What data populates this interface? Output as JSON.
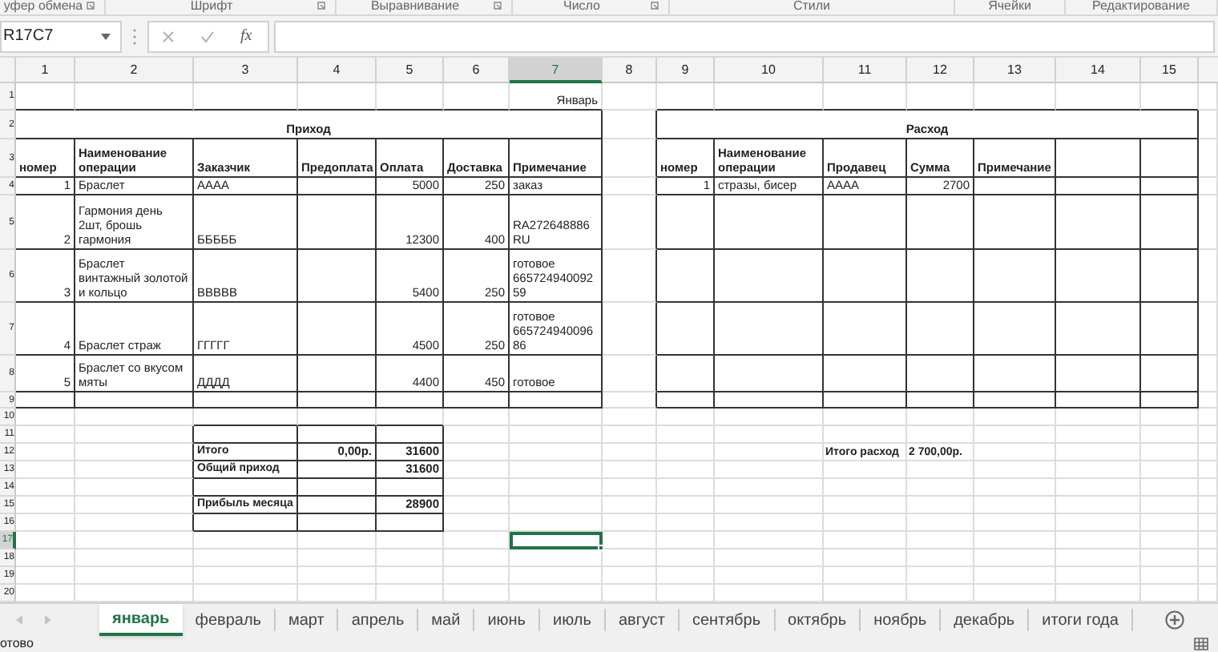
{
  "ribbon_groups": [
    {
      "label": "уфер обмена",
      "launcher": true
    },
    {
      "label": "Шрифт",
      "launcher": true
    },
    {
      "label": "Выравнивание",
      "launcher": true
    },
    {
      "label": "Число",
      "launcher": true
    },
    {
      "label": "Стили",
      "launcher": false
    },
    {
      "label": "Ячейки",
      "launcher": false
    },
    {
      "label": "Редактирование",
      "launcher": false
    }
  ],
  "formula_bar": {
    "name_box": "R17C7",
    "function_button": "fx"
  },
  "columns": [
    {
      "label": "1",
      "selected": false
    },
    {
      "label": "2",
      "selected": false
    },
    {
      "label": "3",
      "selected": false
    },
    {
      "label": "4",
      "selected": false
    },
    {
      "label": "5",
      "selected": false
    },
    {
      "label": "6",
      "selected": false
    },
    {
      "label": "7",
      "selected": true
    },
    {
      "label": "8",
      "selected": false
    },
    {
      "label": "9",
      "selected": false
    },
    {
      "label": "10",
      "selected": false
    },
    {
      "label": "11",
      "selected": false
    },
    {
      "label": "12",
      "selected": false
    },
    {
      "label": "13",
      "selected": false
    },
    {
      "label": "14",
      "selected": false
    },
    {
      "label": "15",
      "selected": false
    }
  ],
  "rows": [
    {
      "label": "1",
      "selected": false
    },
    {
      "label": "2",
      "selected": false
    },
    {
      "label": "3",
      "selected": false
    },
    {
      "label": "4",
      "selected": false
    },
    {
      "label": "5",
      "selected": false
    },
    {
      "label": "6",
      "selected": false
    },
    {
      "label": "7",
      "selected": false
    },
    {
      "label": "8",
      "selected": false
    },
    {
      "label": "9",
      "selected": false
    },
    {
      "label": "10",
      "selected": false
    },
    {
      "label": "11",
      "selected": false
    },
    {
      "label": "12",
      "selected": false
    },
    {
      "label": "13",
      "selected": false
    },
    {
      "label": "14",
      "selected": false
    },
    {
      "label": "15",
      "selected": false
    },
    {
      "label": "16",
      "selected": false
    },
    {
      "label": "17",
      "selected": true
    },
    {
      "label": "18",
      "selected": false
    },
    {
      "label": "19",
      "selected": false
    },
    {
      "label": "20",
      "selected": false
    }
  ],
  "month_label": "Январь",
  "income_table": {
    "title": "Приход",
    "headers": [
      "номер",
      "Наименование операции",
      "Заказчик",
      "Предоплата",
      "Оплата",
      "Доставка",
      "Примечание"
    ],
    "rows": [
      {
        "number": "1",
        "operation": "Браслет",
        "customer": "АААА",
        "payment": "5000",
        "delivery": "250",
        "note": "заказ"
      },
      {
        "number": "2",
        "operation": "Гармония день 2шт, брошь гармония",
        "customer": "БББББ",
        "payment": "12300",
        "delivery": "400",
        "note": "RA272648886RU"
      },
      {
        "number": "3",
        "operation": "Браслет винтажный золотой и кольцо",
        "customer": "ВВВВВ",
        "payment": "5400",
        "delivery": "250",
        "note": "готовое 66572494009259"
      },
      {
        "number": "4",
        "operation": "Браслет страж",
        "customer": "ГГГГГ",
        "payment": "4500",
        "delivery": "250",
        "note": "готовое 66572494009686"
      },
      {
        "number": "5",
        "operation": "Браслет со вкусом мяты",
        "customer": "ДДДД",
        "payment": "4400",
        "delivery": "450",
        "note": "готовое"
      }
    ]
  },
  "expense_table": {
    "title": "Расход",
    "headers": [
      "номер",
      "Наименование операции",
      "Продавец",
      "Сумма",
      "Примечание"
    ],
    "rows": [
      {
        "number": "1",
        "operation": "стразы, бисер",
        "seller": "АААА",
        "sum": "2700"
      }
    ]
  },
  "summary": [
    {
      "kind": "blank"
    },
    {
      "kind": "line",
      "label": "Итого",
      "prepayment": "0,00р.",
      "value": "31600"
    },
    {
      "kind": "line",
      "label": "Общий приход",
      "value": "31600"
    },
    {
      "kind": "blank"
    },
    {
      "kind": "line",
      "label": "Прибыль месяца",
      "value": "28900"
    },
    {
      "kind": "blank"
    }
  ],
  "expense_total": {
    "label": "Итого расход",
    "value": "2 700,00р."
  },
  "sheet_tabs": [
    {
      "label": "январь",
      "selected": true
    },
    {
      "label": "февраль",
      "selected": false
    },
    {
      "label": "март",
      "selected": false
    },
    {
      "label": "апрель",
      "selected": false
    },
    {
      "label": "май",
      "selected": false
    },
    {
      "label": "июнь",
      "selected": false
    },
    {
      "label": "июль",
      "selected": false
    },
    {
      "label": "август",
      "selected": false
    },
    {
      "label": "сентябрь",
      "selected": false
    },
    {
      "label": "октябрь",
      "selected": false
    },
    {
      "label": "ноябрь",
      "selected": false
    },
    {
      "label": "декабрь",
      "selected": false
    },
    {
      "label": "итоги года",
      "selected": false
    }
  ],
  "status": "отово"
}
